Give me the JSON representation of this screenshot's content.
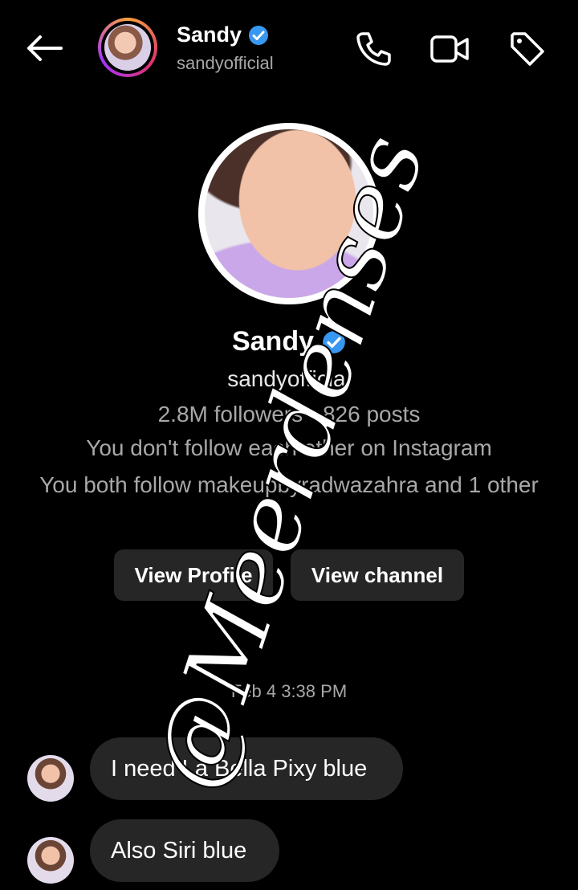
{
  "header": {
    "name": "Sandy",
    "handle": "sandyofficial",
    "icons": [
      "back-arrow-icon",
      "verified-badge-icon",
      "phone-icon",
      "video-camera-icon",
      "tag-icon"
    ]
  },
  "profile": {
    "name": "Sandy",
    "handle": "sandyofficial",
    "stats": "2.8M followers · 826 posts",
    "follow_status": "You don't follow each other on Instagram",
    "mutual": "You both follow makeupbyradwazahra and 1 other",
    "view_profile_label": "View Profile",
    "view_channel_label": "View channel"
  },
  "timestamp": "Feb 4 3:38 PM",
  "messages": [
    {
      "text": "I need La Bella Pixy blue"
    },
    {
      "text": "Also Siri blue"
    }
  ],
  "watermark": "@Meerdenses",
  "colors": {
    "background": "#000000",
    "bubble": "#262626",
    "secondary_text": "#a8a8a8",
    "verified": "#3897f0"
  }
}
